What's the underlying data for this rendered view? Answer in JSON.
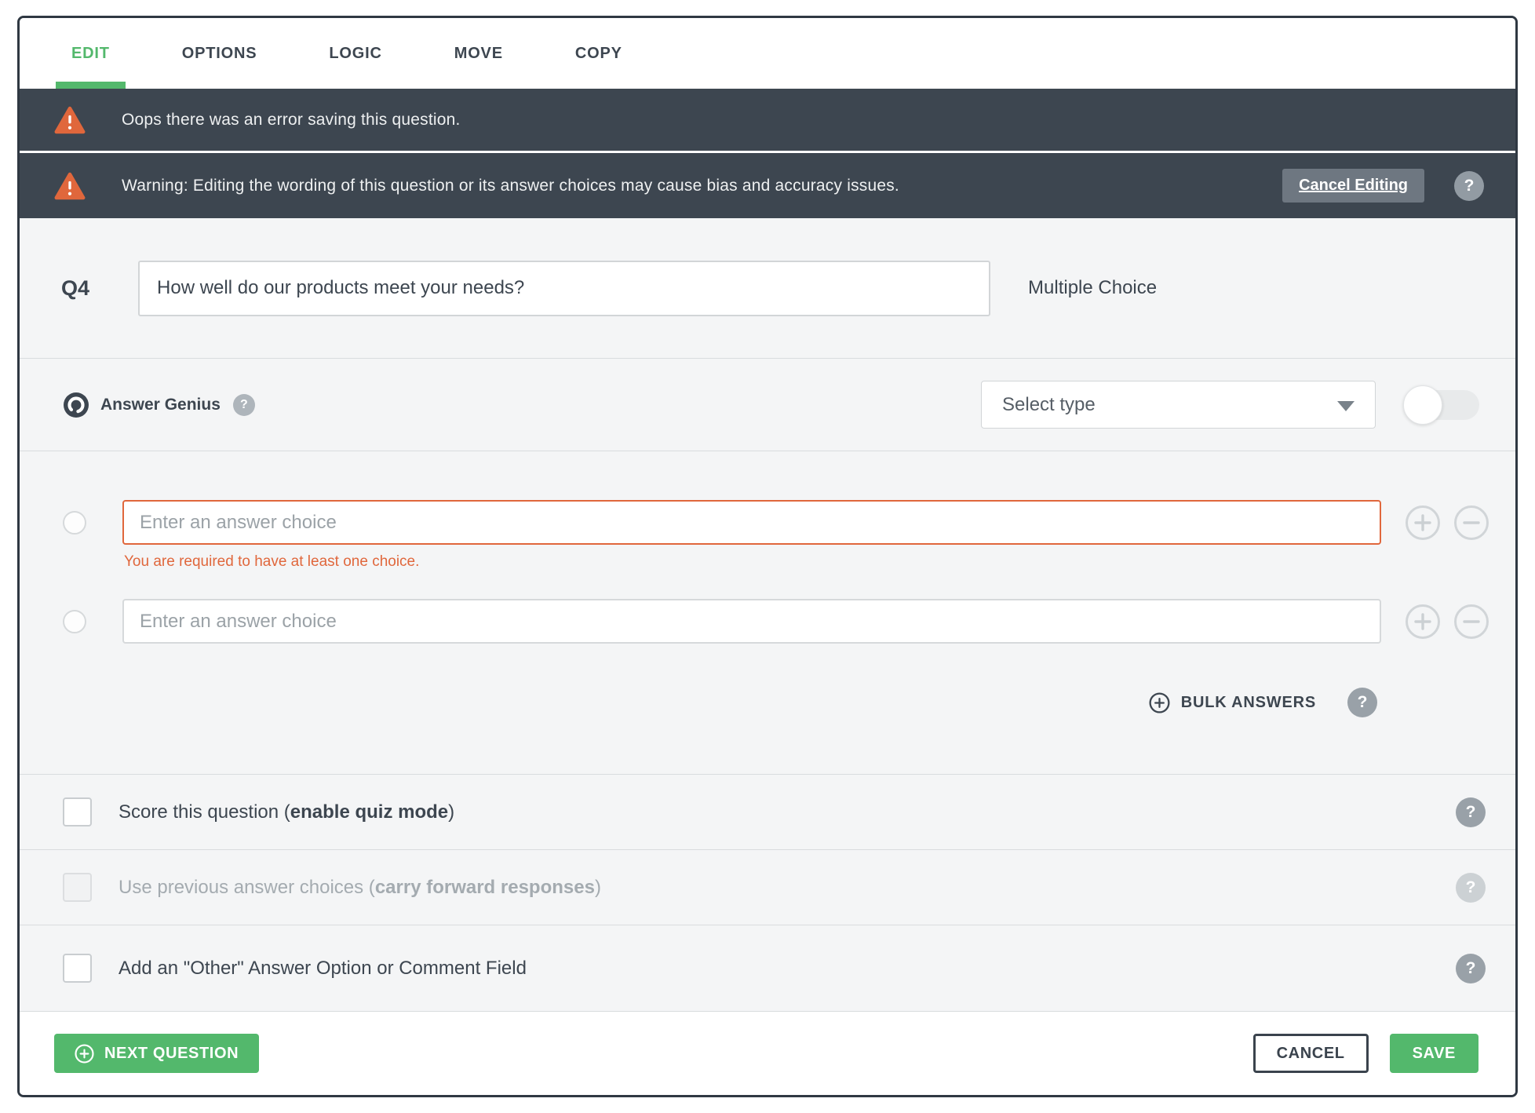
{
  "tabs": [
    {
      "label": "EDIT"
    },
    {
      "label": "OPTIONS"
    },
    {
      "label": "LOGIC"
    },
    {
      "label": "MOVE"
    },
    {
      "label": "COPY"
    }
  ],
  "banners": {
    "error": {
      "text": "Oops there was an error saving this question."
    },
    "warning": {
      "text": "Warning: Editing the wording of this question or its answer choices may cause bias and accuracy issues.",
      "cancel_label": "Cancel Editing"
    }
  },
  "question": {
    "id": "Q4",
    "value": "How well do our products meet your needs?",
    "type": "Multiple Choice"
  },
  "answer_genius": {
    "label": "Answer Genius",
    "select_placeholder": "Select type",
    "toggle_state": "off"
  },
  "answers": {
    "rows": [
      {
        "placeholder": "Enter an answer choice"
      },
      {
        "placeholder": "Enter an answer choice"
      }
    ],
    "error": "You are required to have at least one choice.",
    "bulk_label": "BULK ANSWERS"
  },
  "options": {
    "score": {
      "prefix": "Score this question (",
      "bold": "enable quiz mode",
      "suffix": ")"
    },
    "carry": {
      "prefix": "Use previous answer choices (",
      "bold": "carry forward responses",
      "suffix": ")"
    },
    "other": {
      "label": "Add an \"Other\" Answer Option or Comment Field"
    }
  },
  "footer": {
    "next_label": "NEXT QUESTION",
    "cancel_label": "CANCEL",
    "save_label": "SAVE"
  },
  "icons": {
    "help": "?"
  },
  "colors": {
    "accent_green": "#53b86c",
    "warning_orange": "#e0673c",
    "banner_dark": "#3d4650",
    "text_dark": "#3d4650"
  }
}
